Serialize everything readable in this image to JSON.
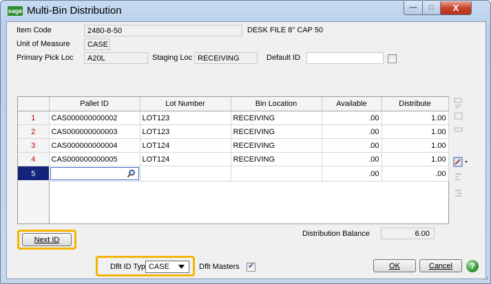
{
  "window": {
    "title": "Multi-Bin Distribution",
    "app_icon_text": "sage",
    "minimize_glyph": "—",
    "maximize_glyph": "□",
    "close_glyph": "X"
  },
  "header": {
    "item_code_label": "Item Code",
    "item_code_value": "2480-8-50",
    "item_description": "DESK FILE 8\" CAP 50",
    "uom_label": "Unit of Measure",
    "uom_value": "CASE",
    "primary_pick_label": "Primary Pick Loc",
    "primary_pick_value": "A20L",
    "staging_label": "Staging Loc",
    "staging_value": "RECEIVING",
    "default_id_label": "Default ID",
    "default_id_value": "",
    "default_id_checked": false
  },
  "grid": {
    "columns": [
      "Pallet ID",
      "Lot Number",
      "Bin Location",
      "Available",
      "Distribute"
    ],
    "rows": [
      {
        "num": "1",
        "pallet_id": "CAS000000000002",
        "lot": "LOT123",
        "bin": "RECEIVING",
        "available": ".00",
        "distribute": "1.00"
      },
      {
        "num": "2",
        "pallet_id": "CAS000000000003",
        "lot": "LOT123",
        "bin": "RECEIVING",
        "available": ".00",
        "distribute": "1.00"
      },
      {
        "num": "3",
        "pallet_id": "CAS000000000004",
        "lot": "LOT124",
        "bin": "RECEIVING",
        "available": ".00",
        "distribute": "1.00"
      },
      {
        "num": "4",
        "pallet_id": "CAS000000000005",
        "lot": "LOT124",
        "bin": "RECEIVING",
        "available": ".00",
        "distribute": "1.00"
      },
      {
        "num": "5",
        "pallet_id": "",
        "lot": "",
        "bin": "",
        "available": ".00",
        "distribute": ".00"
      }
    ]
  },
  "footer": {
    "next_id_label": "Next ID",
    "distribution_balance_label": "Distribution Balance",
    "distribution_balance_value": "6.00",
    "dflt_id_type_label": "Dflt ID Type",
    "dflt_id_type_value": "CASE",
    "dflt_masters_label": "Dflt Masters",
    "dflt_masters_checked": true,
    "ok_label": "OK",
    "cancel_label": "Cancel",
    "help_glyph": "?"
  },
  "colors": {
    "highlight": "#f5b400",
    "row_number": "#c00000",
    "selected_row": "#14247a"
  }
}
